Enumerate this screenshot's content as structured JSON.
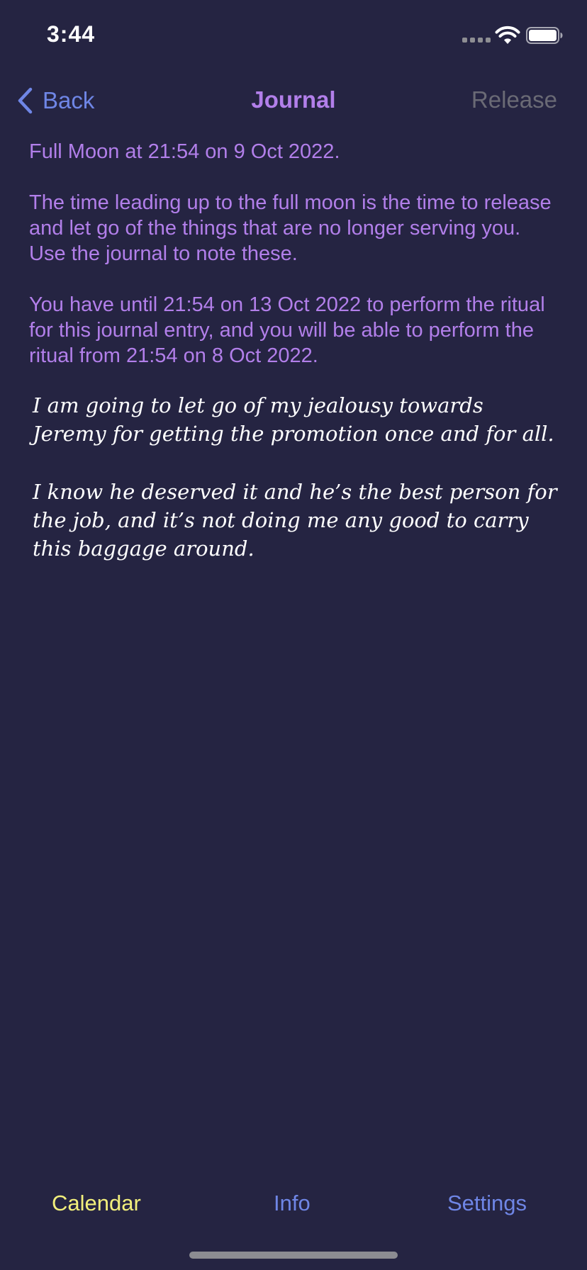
{
  "status_bar": {
    "time": "3:44"
  },
  "nav": {
    "back_label": "Back",
    "title": "Journal",
    "release_label": "Release"
  },
  "info": {
    "moon_event": "Full Moon at 21:54 on 9 Oct 2022.",
    "description": "The time leading up to the full moon is the time to release and let go of the things that are no longer serving you. Use the journal to note these.",
    "deadline": "You have until 21:54 on 13 Oct 2022 to perform the ritual for this journal entry, and you will be able to perform the ritual from 21:54 on 8 Oct 2022."
  },
  "journal": {
    "paragraphs": [
      "I am going to let go of my jealousy towards Jeremy for getting the promotion once and for all.",
      "I know he deserved it and he’s the best person for the job, and it’s not doing me any good to carry this baggage around."
    ]
  },
  "tabs": [
    {
      "label": "Calendar",
      "active": true
    },
    {
      "label": "Info",
      "active": false
    },
    {
      "label": "Settings",
      "active": false
    }
  ],
  "colors": {
    "background": "#252442",
    "accent_purple": "#b27fea",
    "link_blue": "#6f86e6",
    "active_tab_yellow": "#f2ef7c",
    "disabled_gray": "#6a6a75"
  }
}
